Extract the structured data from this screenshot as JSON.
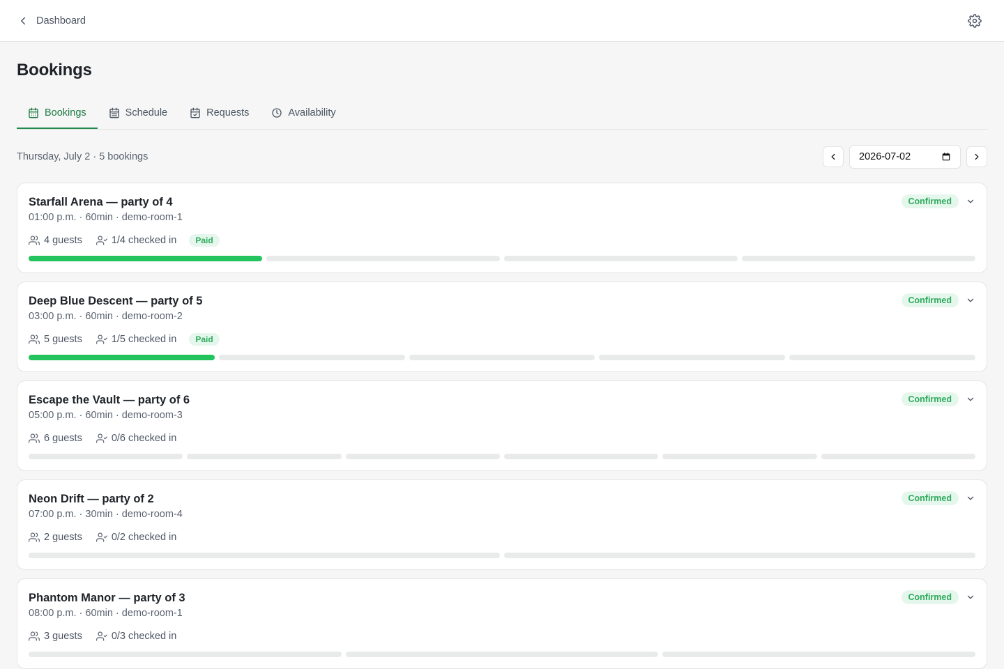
{
  "header": {
    "back_label": "Dashboard"
  },
  "page": {
    "title": "Bookings"
  },
  "tabs": [
    {
      "label": "Bookings",
      "icon": "calendar-icon",
      "active": true
    },
    {
      "label": "Schedule",
      "icon": "calendar-grid-icon",
      "active": false
    },
    {
      "label": "Requests",
      "icon": "calendar-check-icon",
      "active": false
    },
    {
      "label": "Availability",
      "icon": "clock-icon",
      "active": false
    }
  ],
  "summary": {
    "text": "Thursday, July 2 · 5 bookings"
  },
  "date_picker": {
    "value": "2026-07-02"
  },
  "colors": {
    "accent": "#1f7a45",
    "progress": "#23c45e",
    "badge_bg": "#e5f7ec",
    "badge_text": "#2faa5d"
  },
  "bookings": [
    {
      "title": "Starfall Arena — party of 4",
      "details": "01:00 p.m. · 60min · demo-room-1",
      "guests": "4 guests",
      "checked_in": "1/4 checked in",
      "paid": "Paid",
      "status": "Confirmed",
      "party_size": 4,
      "checked_count": 1
    },
    {
      "title": "Deep Blue Descent — party of 5",
      "details": "03:00 p.m. · 60min · demo-room-2",
      "guests": "5 guests",
      "checked_in": "1/5 checked in",
      "paid": "Paid",
      "status": "Confirmed",
      "party_size": 5,
      "checked_count": 1
    },
    {
      "title": "Escape the Vault — party of 6",
      "details": "05:00 p.m. · 60min · demo-room-3",
      "guests": "6 guests",
      "checked_in": "0/6 checked in",
      "paid": "",
      "status": "Confirmed",
      "party_size": 6,
      "checked_count": 0
    },
    {
      "title": "Neon Drift — party of 2",
      "details": "07:00 p.m. · 30min · demo-room-4",
      "guests": "2 guests",
      "checked_in": "0/2 checked in",
      "paid": "",
      "status": "Confirmed",
      "party_size": 2,
      "checked_count": 0
    },
    {
      "title": "Phantom Manor — party of 3",
      "details": "08:00 p.m. · 60min · demo-room-1",
      "guests": "3 guests",
      "checked_in": "0/3 checked in",
      "paid": "",
      "status": "Confirmed",
      "party_size": 3,
      "checked_count": 0
    }
  ]
}
